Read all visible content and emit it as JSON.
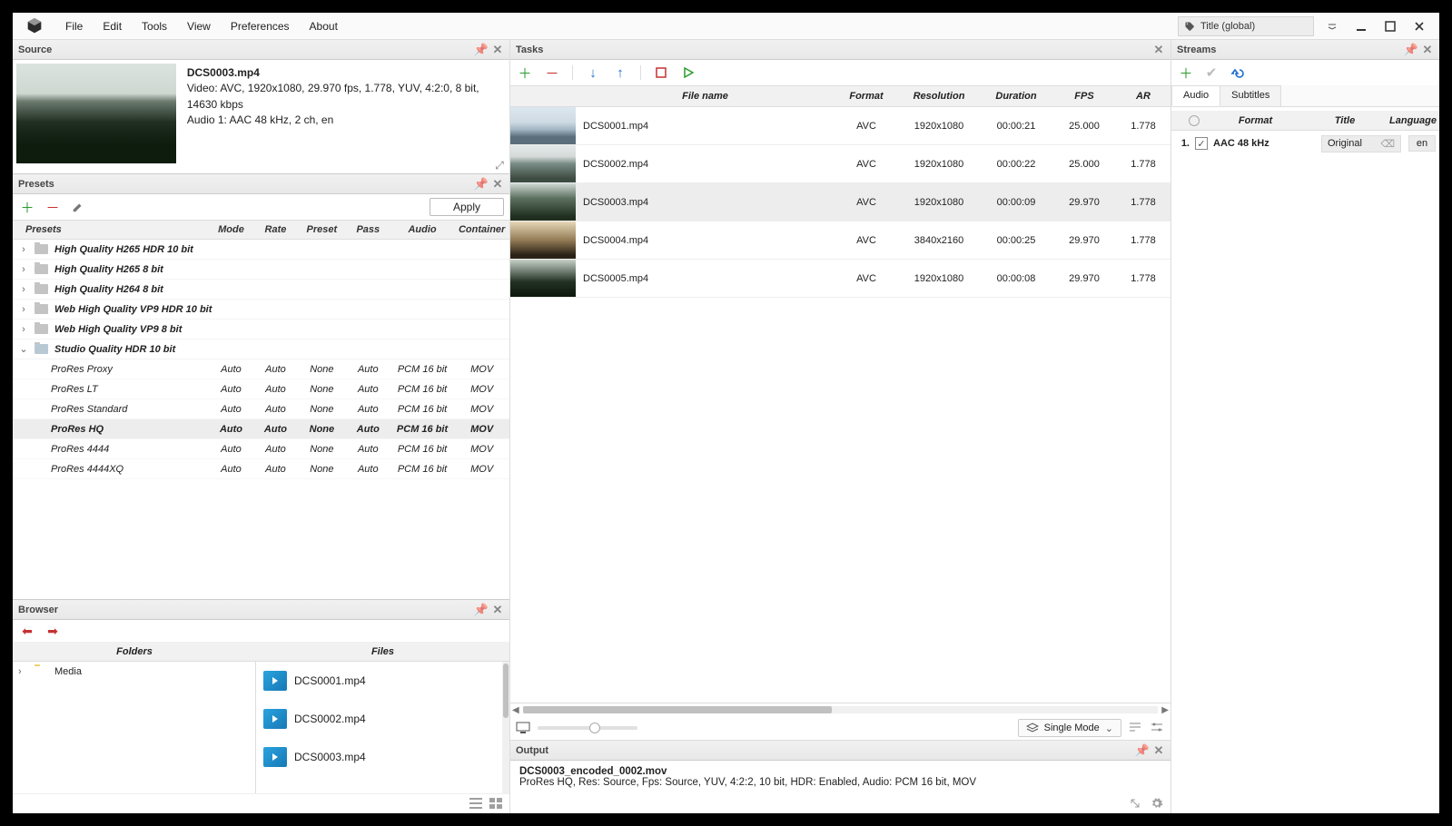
{
  "menubar": {
    "items": [
      "File",
      "Edit",
      "Tools",
      "View",
      "Preferences",
      "About"
    ],
    "title_label": "Title  (global)"
  },
  "source": {
    "panel_title": "Source",
    "filename": "DCS0003.mp4",
    "video_line": "Video: AVC, 1920x1080, 29.970 fps, 1.778, YUV, 4:2:0, 8 bit, 14630 kbps",
    "audio_line": "Audio 1: AAC  48 kHz, 2 ch, en"
  },
  "presets": {
    "panel_title": "Presets",
    "apply_label": "Apply",
    "columns": {
      "presets": "Presets",
      "mode": "Mode",
      "rate": "Rate",
      "preset": "Preset",
      "pass": "Pass",
      "audio": "Audio",
      "container": "Container"
    },
    "folders": [
      {
        "name": "High Quality H265 HDR 10 bit",
        "expanded": false
      },
      {
        "name": "High Quality H265 8 bit",
        "expanded": false
      },
      {
        "name": "High Quality H264 8 bit",
        "expanded": false
      },
      {
        "name": "Web High Quality VP9 HDR 10 bit",
        "expanded": false
      },
      {
        "name": "Web High Quality VP9 8 bit",
        "expanded": false
      },
      {
        "name": "Studio Quality HDR 10 bit",
        "expanded": true
      }
    ],
    "items": [
      {
        "name": "ProRes Proxy",
        "mode": "Auto",
        "rate": "Auto",
        "preset": "None",
        "pass": "Auto",
        "audio": "PCM 16 bit",
        "container": "MOV",
        "selected": false
      },
      {
        "name": "ProRes LT",
        "mode": "Auto",
        "rate": "Auto",
        "preset": "None",
        "pass": "Auto",
        "audio": "PCM 16 bit",
        "container": "MOV",
        "selected": false
      },
      {
        "name": "ProRes Standard",
        "mode": "Auto",
        "rate": "Auto",
        "preset": "None",
        "pass": "Auto",
        "audio": "PCM 16 bit",
        "container": "MOV",
        "selected": false
      },
      {
        "name": "ProRes HQ",
        "mode": "Auto",
        "rate": "Auto",
        "preset": "None",
        "pass": "Auto",
        "audio": "PCM 16 bit",
        "container": "MOV",
        "selected": true
      },
      {
        "name": "ProRes 4444",
        "mode": "Auto",
        "rate": "Auto",
        "preset": "None",
        "pass": "Auto",
        "audio": "PCM 16 bit",
        "container": "MOV",
        "selected": false
      },
      {
        "name": "ProRes 4444XQ",
        "mode": "Auto",
        "rate": "Auto",
        "preset": "None",
        "pass": "Auto",
        "audio": "PCM 16 bit",
        "container": "MOV",
        "selected": false
      }
    ]
  },
  "browser": {
    "panel_title": "Browser",
    "col_folders": "Folders",
    "col_files": "Files",
    "root_folder": "Media",
    "files": [
      "DCS0001.mp4",
      "DCS0002.mp4",
      "DCS0003.mp4"
    ]
  },
  "tasks": {
    "panel_title": "Tasks",
    "columns": {
      "file": "File name",
      "format": "Format",
      "res": "Resolution",
      "dur": "Duration",
      "fps": "FPS",
      "ar": "AR"
    },
    "rows": [
      {
        "thumb": "t1",
        "file": "DCS0001.mp4",
        "format": "AVC",
        "res": "1920x1080",
        "dur": "00:00:21",
        "fps": "25.000",
        "ar": "1.778",
        "selected": false
      },
      {
        "thumb": "t2",
        "file": "DCS0002.mp4",
        "format": "AVC",
        "res": "1920x1080",
        "dur": "00:00:22",
        "fps": "25.000",
        "ar": "1.778",
        "selected": false
      },
      {
        "thumb": "t3",
        "file": "DCS0003.mp4",
        "format": "AVC",
        "res": "1920x1080",
        "dur": "00:00:09",
        "fps": "29.970",
        "ar": "1.778",
        "selected": true
      },
      {
        "thumb": "t4",
        "file": "DCS0004.mp4",
        "format": "AVC",
        "res": "3840x2160",
        "dur": "00:00:25",
        "fps": "29.970",
        "ar": "1.778",
        "selected": false
      },
      {
        "thumb": "t5",
        "file": "DCS0005.mp4",
        "format": "AVC",
        "res": "1920x1080",
        "dur": "00:00:08",
        "fps": "29.970",
        "ar": "1.778",
        "selected": false
      }
    ],
    "mode_label": "Single Mode"
  },
  "output": {
    "panel_title": "Output",
    "filename": "DCS0003_encoded_0002.mov",
    "summary": "ProRes HQ, Res: Source, Fps: Source, YUV, 4:2:2, 10 bit, HDR: Enabled, Audio: PCM 16 bit, MOV"
  },
  "streams": {
    "panel_title": "Streams",
    "tabs": {
      "audio": "Audio",
      "subtitles": "Subtitles"
    },
    "columns": {
      "format": "Format",
      "title": "Title",
      "language": "Language"
    },
    "rows": [
      {
        "index": "1.",
        "checked": true,
        "format": "AAC  48 kHz",
        "title": "Original",
        "language": "en"
      }
    ]
  }
}
